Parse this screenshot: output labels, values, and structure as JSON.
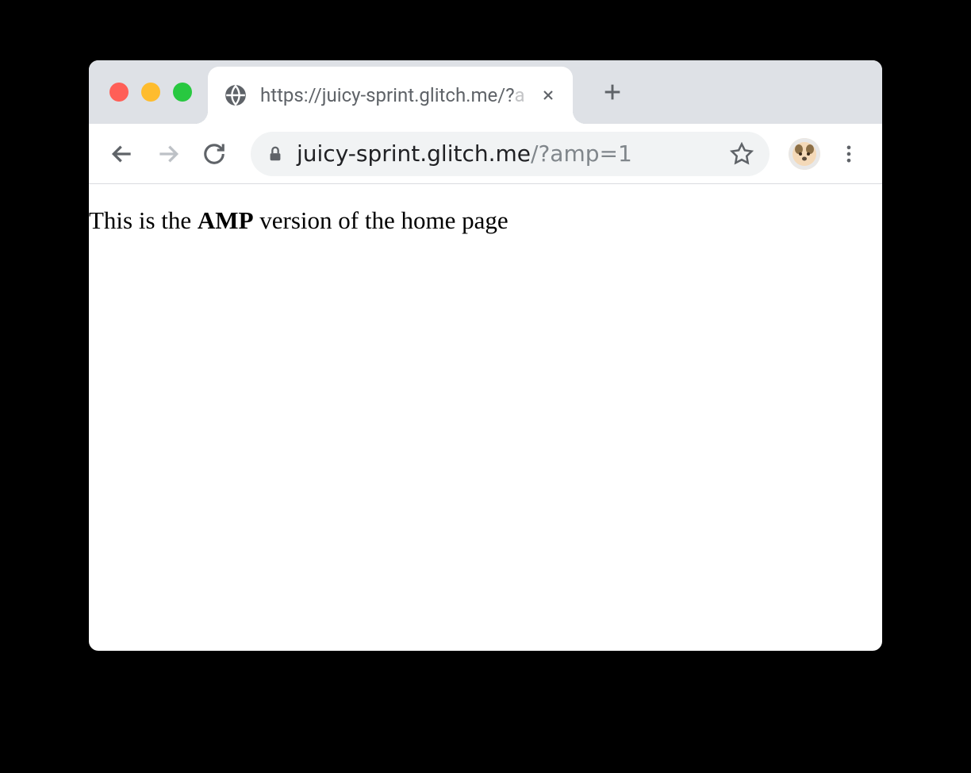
{
  "tab": {
    "title_visible": "https://juicy-sprint.glitch.me/?",
    "title_faded": "a",
    "favicon": "globe-icon"
  },
  "toolbar": {
    "url_host": "juicy-sprint.glitch.me",
    "url_query": "/?amp=1"
  },
  "page": {
    "text_before": "This is the ",
    "text_bold": "AMP",
    "text_after": " version of the home page"
  }
}
